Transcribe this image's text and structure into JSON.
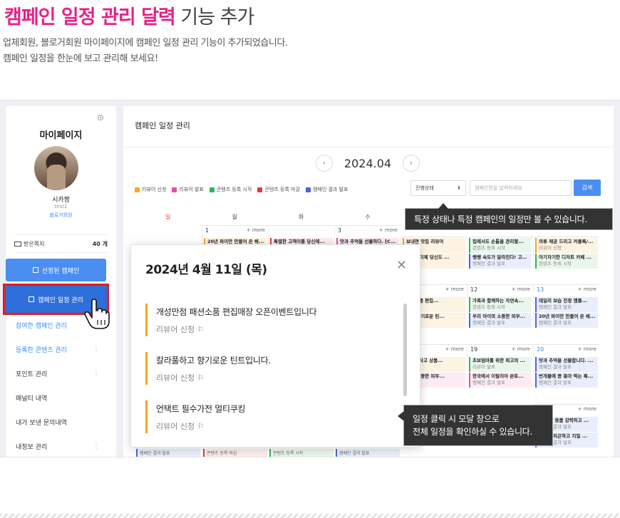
{
  "hero": {
    "title_highlight": "캠페인 일정 관리 달력",
    "title_rest": "기능 추가",
    "desc_line1": "업체회원, 블로거회원 마이페이지에 캠페인 일정 관리 기능이 추가되었습니다.",
    "desc_line2": "캠페인 일정을 한눈에 보고 관리해 보세요!"
  },
  "sidebar": {
    "title": "마이페이지",
    "nickname": "시카짱",
    "user_id": "test2",
    "grade": "블로거회원",
    "messages_label": "받은쪽지",
    "messages_count": "40 개",
    "btn_selected": "선정된 캠페인",
    "btn_schedule": "캠페인 일정 관리",
    "menu": [
      {
        "label": "참여한 캠페인 관리"
      },
      {
        "label": "등록한 콘텐츠 관리"
      },
      {
        "label": "포인트 관리"
      },
      {
        "label": "패널티 내역"
      },
      {
        "label": "내가 보낸 문의내역"
      },
      {
        "label": "내정보 관리"
      }
    ],
    "menu_dots": "⋮"
  },
  "calendar": {
    "panel_title": "캠페인 일정 관리",
    "month": "2024.04",
    "prev": "‹",
    "next": "›",
    "legend": [
      {
        "label": "리뷰어 신청",
        "color": "#f5a623"
      },
      {
        "label": "리뷰어 발표",
        "color": "#e84ca8"
      },
      {
        "label": "콘텐츠 등록 시작",
        "color": "#2fb45a"
      },
      {
        "label": "콘텐츠 등록 마감",
        "color": "#e23c3c"
      },
      {
        "label": "캠페인 결과 발표",
        "color": "#4a63e0"
      }
    ],
    "status_select": "진행상태",
    "search_placeholder": "캠페인명을 입력하세요.",
    "search_button": "검색",
    "weekdays": [
      "일",
      "월",
      "화",
      "수",
      "목",
      "금",
      "토"
    ],
    "more": "+ more",
    "days": {
      "d1": "1",
      "d3": "3",
      "d12": "12",
      "d13": "13",
      "d19": "19",
      "d20": "20"
    },
    "events": {
      "d1_e1_t": "20년 파이만 만들어 온 쉐...",
      "d2_e1_t": "특별한 고객이를 당신에...",
      "d3_e1_t": "맛과 추억을 선물하다. [C...",
      "fri_e1_t": "집에서도 손톱을 관리할...",
      "fri_e1_s": "콘텐츠 등록 시작",
      "fri_e2_t": "쌩쌩 속도가 달라진다! 고백...",
      "fri_e2_s": "캠페인 결과 발표",
      "sat_e1_t": "의류 제공 드리고 커플룩/...",
      "sat_e1_s": "리뷰어 신청",
      "sat_e2_t": "아기자기한 디저트 카페 ...",
      "sat_e2_s": "콘텐츠 등록 시작",
      "fri2_e1_t": "가족과 함께하는 자연속...",
      "fri2_e1_s": "콘텐츠 등록 시작",
      "fri2_e2_t": "우리 아이의 소중한 피부...",
      "fri2_e2_s": "캠페인 결과 발표",
      "sat2_e1_t": "데일리 보습 진정 앰플...",
      "sat2_e1_s": "캠페인 결과 발표",
      "sat2_e2_t": "20년 파이만 만들어 온 쉐...",
      "sat2_e2_s": "캠페인 결과 발표",
      "fri3_e1_t": "초보엄마를 위한 최고의 ...",
      "fri3_e1_s": "리뷰어 발표",
      "fri3_e2_t": "한국에서 이탈리아 본토...",
      "fri3_e2_s": "캠페인 결과 발표",
      "sat3_e1_t": "맛과 추억을 선물합니다. ...",
      "sat3_e1_s": "캠페인 결과 발표",
      "sat3_e2_t": "번개불에 콩 볶아 먹는 특...",
      "sat3_e2_s": "캠페인 결과 발표",
      "sat4_e1_t": "레드 수 용품 강력하고 ...",
      "sat4_e1_s": "캠페인 결과 발표",
      "sat4_e2_t": "외부에 피곤하고 지질 ...",
      "sat4_e2_s": "캠페인 결과 발표",
      "thu_e1_t": "보내면 맛집 리뷰어",
      "thu_e2_t": "...부! 이제 당신도 ...",
      "thu_e3_t": "패션소품 편집...",
      "thu_e4_t": "하고 향기로운 틴...",
      "thu_e5_t": "하기이사고 상품...",
      "thu_e6_t": "마의 소중한 피부..."
    },
    "bottom_strip": {
      "s1": "캠페인 결과 발표",
      "s2": "콘텐츠 등록 마감",
      "s3": "콘텐츠 등록 시작",
      "s4": "캠페인 결과 발표"
    }
  },
  "modal": {
    "date_title": "2024년 4월 11일 (목)",
    "close": "✕",
    "items": [
      {
        "title": "개성만점 패션소품 편집매장 오픈이벤트입니다",
        "status": "리뷰어 신청"
      },
      {
        "title": "칼라풀하고 향기로운 틴트입니다.",
        "status": "리뷰어 신청"
      },
      {
        "title": "언택트 필수가전 멀티쿠킹",
        "status": "리뷰어 신청"
      }
    ]
  },
  "tooltips": {
    "tip1": "특정 상태나 특정 캠페인의 일정만 볼 수 있습니다.",
    "tip2_line1": "일정 클릭 시 모달 창으로",
    "tip2_line2": "전체 일정을 확인하실 수 있습니다."
  }
}
